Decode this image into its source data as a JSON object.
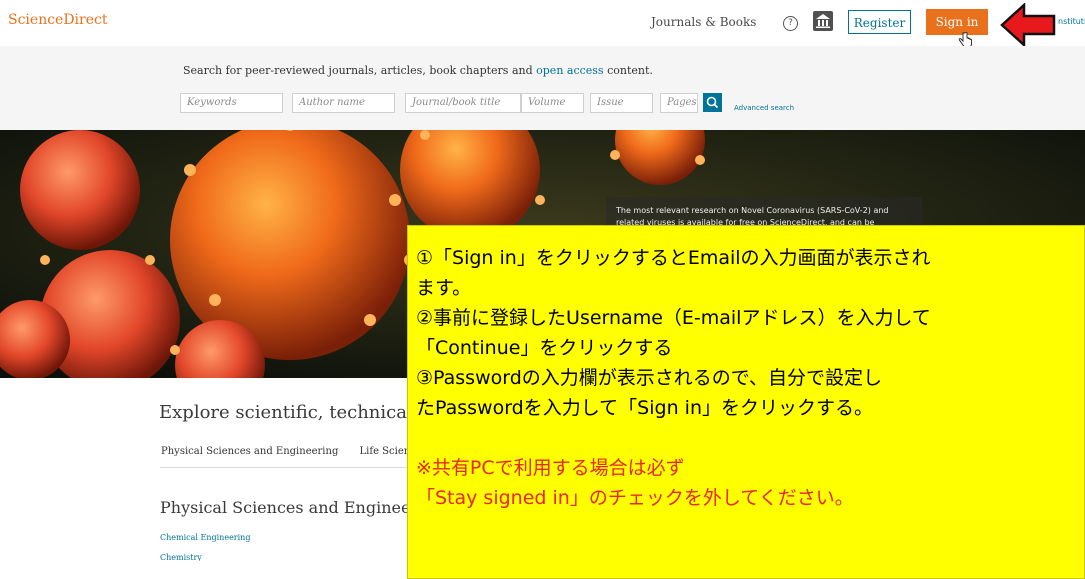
{
  "header": {
    "brand": "ScienceDirect",
    "journals_books": "Journals & Books",
    "help_icon": "question-circle-icon",
    "institution_icon": "institution-icon",
    "register_label": "Register",
    "signin_label": "Sign in",
    "institution_link": "nstitutio",
    "accent_color": "#e9711c",
    "link_color": "#007398"
  },
  "search": {
    "intro_prefix": "Search for peer-reviewed journals, articles, book chapters and",
    "intro_link": "open access",
    "intro_suffix": "content.",
    "placeholders": {
      "keywords": "Keywords",
      "author": "Author name",
      "journal": "Journal/book title",
      "volume": "Volume",
      "issue": "Issue",
      "pages": "Pages"
    },
    "search_icon": "search-icon",
    "advanced_label": "Advanced search"
  },
  "hero": {
    "caption_line1": "The most relevant research on Novel Coronavirus (SARS-CoV-2) and",
    "caption_line2": "related viruses is available for free on ScienceDirect, and can be"
  },
  "explore": {
    "title": "Explore scientific, technica",
    "tabs": [
      "Physical Sciences and Engineering",
      "Life Scien"
    ],
    "section_title": "Physical Sciences and Engineeri",
    "links": [
      "Chemical Engineering",
      "Chemistry"
    ]
  },
  "annotation": {
    "line1": "①「Sign in」をクリックするとEmailの入力画面が表示され",
    "line2": "ます。",
    "line3": "②事前に登録したUsername（E-mailアドレス）を入力して",
    "line4": "「Continue」をクリックする",
    "line5": "③Passwordの入力欄が表示されるので、自分で設定し",
    "line6": "たPasswordを入力して「Sign in」をクリックする。",
    "warn1": "※共有PCで利用する場合は必ず",
    "warn2": "「Stay signed in」のチェックを外してください。"
  }
}
